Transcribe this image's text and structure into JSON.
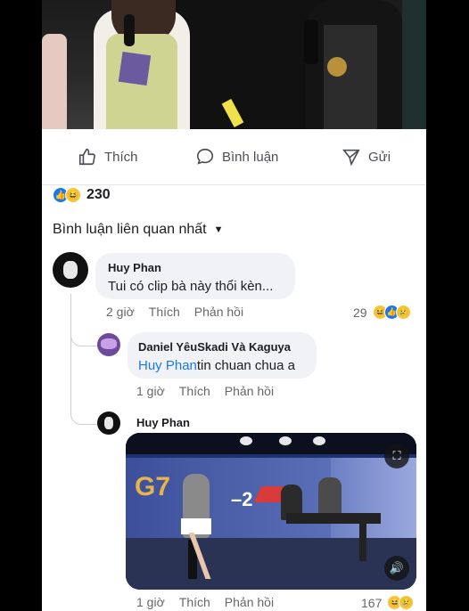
{
  "actions": {
    "like": "Thích",
    "comment": "Bình luận",
    "share": "Gửi"
  },
  "reactions": {
    "count": "230"
  },
  "sort": {
    "label": "Bình luận liên quan nhất"
  },
  "comments": [
    {
      "author": "Huy Phan",
      "text": "Tui có clip bà này thổi kèn...",
      "time": "2 giờ",
      "like": "Thích",
      "reply": "Phản hồi",
      "reactions": "29"
    },
    {
      "author": "Daniel YêuSkadi Và Kaguya",
      "mention": "Huy Phan",
      "text": "tin chuan chua a",
      "time": "1 giờ",
      "like": "Thích",
      "reply": "Phản hồi"
    },
    {
      "author": "Huy Phan",
      "time": "1 giờ",
      "like": "Thích",
      "reply": "Phản hồi",
      "reactions": "167"
    }
  ],
  "colors": {
    "accent": "#1877f2",
    "bubble": "#f0f2f5",
    "meta": "#65676b"
  }
}
